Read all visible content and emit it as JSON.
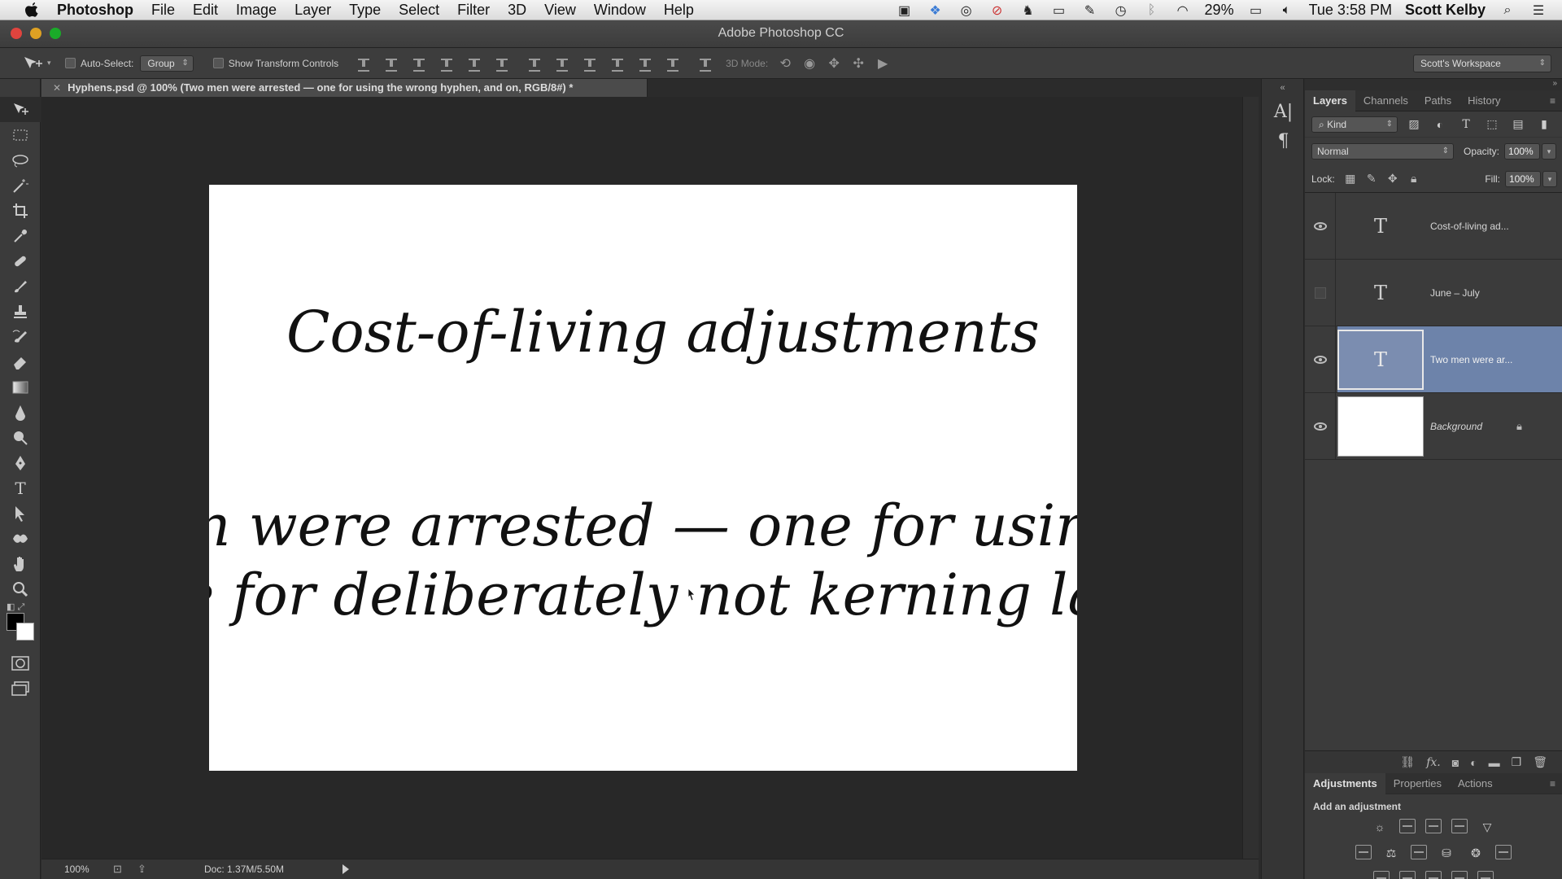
{
  "menubar": {
    "app_name": "Photoshop",
    "menus": [
      "File",
      "Edit",
      "Image",
      "Layer",
      "Type",
      "Select",
      "Filter",
      "3D",
      "View",
      "Window",
      "Help"
    ],
    "battery": "29%",
    "clock": "Tue 3:58 PM",
    "user": "Scott Kelby",
    "icons": [
      "camera-icon",
      "dropbox-icon",
      "sync-icon",
      "stop-icon",
      "evernote-icon",
      "display-icon",
      "pen-icon",
      "time-machine-icon",
      "bluetooth-icon",
      "wifi-icon",
      "battery-icon",
      "volume-icon",
      "spotlight-icon",
      "list-icon"
    ]
  },
  "window": {
    "title": "Adobe Photoshop CC"
  },
  "options_bar": {
    "auto_select_label": "Auto-Select:",
    "auto_select_value": "Group",
    "transform_label": "Show Transform Controls",
    "mode_label": "3D Mode:",
    "workspace": "Scott's Workspace"
  },
  "document": {
    "tab_title": "Hyphens.psd @ 100% (Two men were arrested — one for using the wrong hyphen,  and on, RGB/8#) *",
    "line1": "Cost-of-living adjustments",
    "line2": "en were arrested — one for using th",
    "line3": "e for deliberately not kerning large"
  },
  "status": {
    "zoom": "100%",
    "doc_info": "Doc: 1.37M/5.50M"
  },
  "layers_panel": {
    "tabs": [
      "Layers",
      "Channels",
      "Paths",
      "History"
    ],
    "filter_kind": "Kind",
    "blend_mode": "Normal",
    "opacity_label": "Opacity:",
    "opacity_value": "100%",
    "lock_label": "Lock:",
    "fill_label": "Fill:",
    "fill_value": "100%",
    "layers": [
      {
        "name": "Cost-of-living ad...",
        "thumb": "T",
        "visible": true,
        "selected": false
      },
      {
        "name": "June – July",
        "thumb": "T",
        "visible": false,
        "selected": false
      },
      {
        "name": "Two men were ar...",
        "thumb": "T",
        "visible": true,
        "selected": true
      },
      {
        "name": "Background",
        "thumb": "",
        "visible": true,
        "selected": false,
        "locked": true
      }
    ]
  },
  "adjustments_panel": {
    "tabs": [
      "Adjustments",
      "Properties",
      "Actions"
    ],
    "title": "Add an adjustment"
  },
  "colors": {
    "selection": "#6d83aa",
    "panel_bg": "#3b3b3b",
    "canvas": "#ffffff"
  }
}
